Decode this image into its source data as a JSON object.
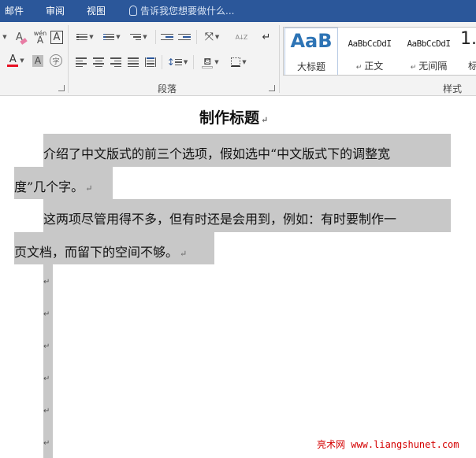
{
  "menu": {
    "items": [
      "邮件",
      "审阅",
      "视图"
    ],
    "tell_me": "告诉我您想要做什么..."
  },
  "ribbon": {
    "font_group": {
      "clear_format_glyph": "A",
      "phonetic_top": "wén",
      "phonetic_bottom": "A",
      "char_border_glyph": "A",
      "font_color_glyph": "A",
      "char_shading_glyph": "A",
      "enclose_glyph": "字",
      "font_color": "#e81123"
    },
    "paragraph_group": {
      "label": "段落",
      "sort_glyph": "A↓Z",
      "show_marks_glyph": "↵"
    },
    "styles_group": {
      "label": "样式",
      "tiles": [
        {
          "sample": "AaB",
          "name": "大标题"
        },
        {
          "sample": "AaBbCcDdI",
          "name": "正文"
        },
        {
          "sample": "AaBbCcDdI",
          "name": "无间隔"
        },
        {
          "sample": "1.",
          "name": "标"
        }
      ]
    }
  },
  "document": {
    "title": "制作标题",
    "lines": [
      "介绍了中文版式的前三个选项，假如选中“中文版式下的调整宽",
      "度”几个字。",
      "这两项尽管用得不多，但有时还是会用到，例如：有时要制作一",
      "页文档，而留下的空间不够。"
    ],
    "paragraph_mark": "↵",
    "empty_paragraph_count": 6,
    "selection_color": "#c8c8c8"
  },
  "watermark": "亮术网 www.liangshunet.com"
}
